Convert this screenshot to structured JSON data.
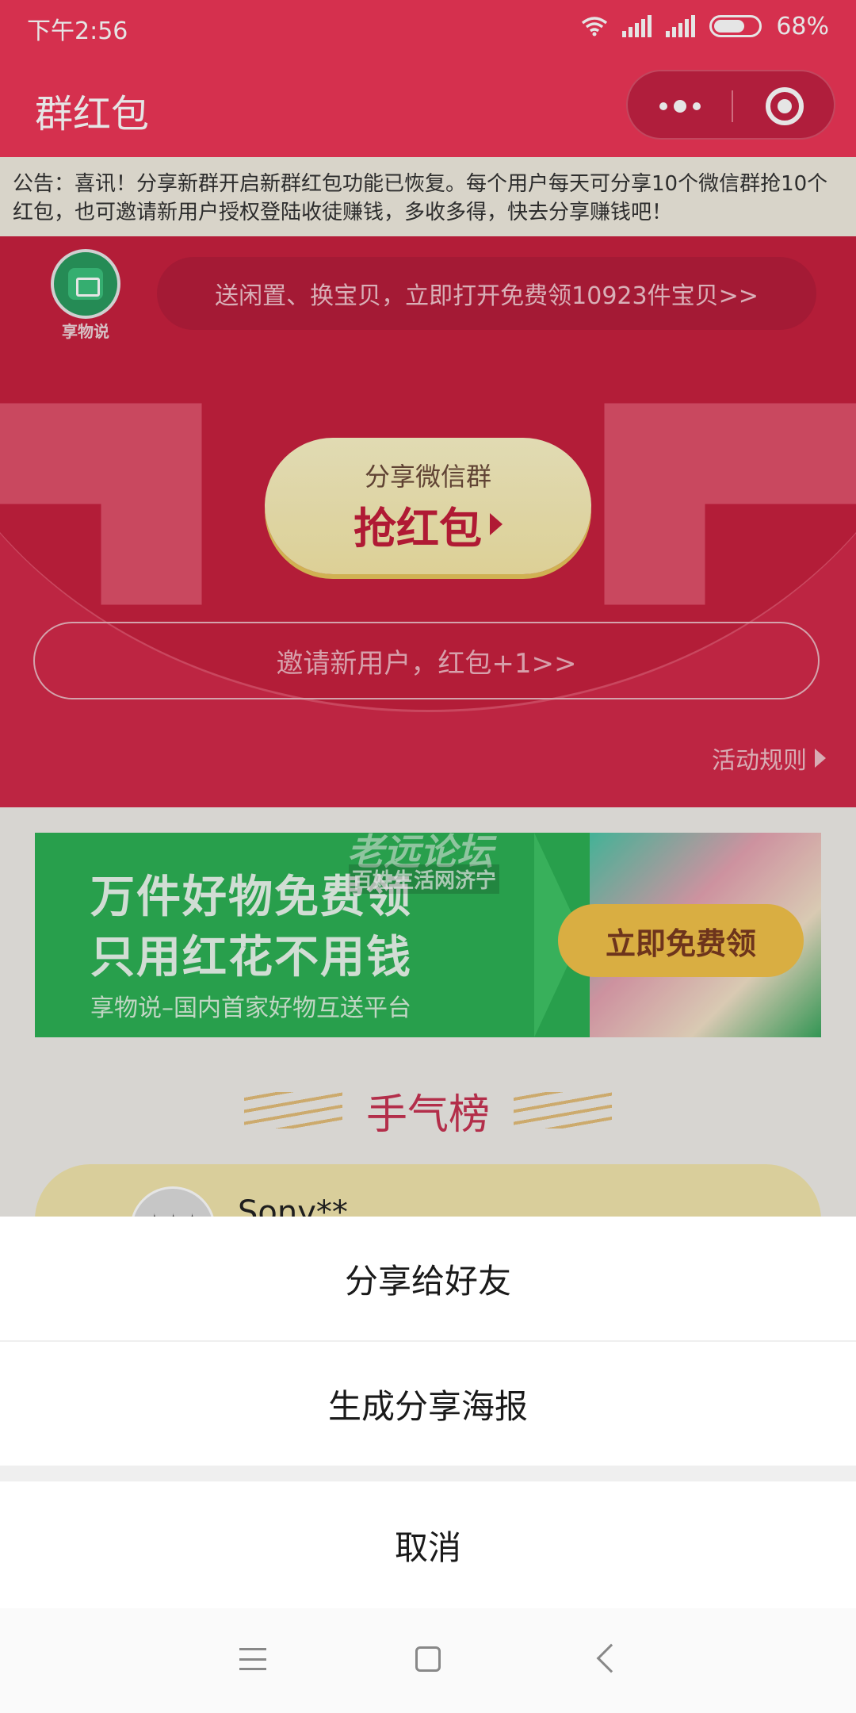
{
  "status_bar": {
    "time": "下午2:56",
    "battery": "68%"
  },
  "title_bar": {
    "title": "群红包"
  },
  "notice": {
    "text": "公告：喜讯！分享新群开启新群红包功能已恢复。每个用户每天可分享10个微信群抢10个红包，也可邀请新用户授权登陆收徒赚钱，多收多得，快去分享赚钱吧！"
  },
  "red_section": {
    "logo_label": "享物说",
    "promo_text": "送闲置、换宝贝，立即打开免费领10923件宝贝>>",
    "grab_sub": "分享微信群",
    "grab_main": "抢红包",
    "invite_text": "邀请新用户，红包+1>>",
    "rules_text": "活动规则"
  },
  "banner": {
    "line1": "万件好物免费领",
    "line2": "只用红花不用钱",
    "line3": "享物说–国内首家好物互送平台",
    "cta": "立即免费领"
  },
  "watermark": {
    "line1": "老远论坛",
    "line2": "百姓生活网济宁"
  },
  "luck_board": {
    "title": "手气榜",
    "first_user": "Sony**",
    "avatar_mark": "✦✦✦"
  },
  "action_sheet": {
    "option1": "分享给好友",
    "option2": "生成分享海报",
    "cancel": "取消"
  },
  "colors": {
    "brand_red": "#ee3657",
    "banner_green": "#2db155",
    "gold": "#f2c24a"
  }
}
